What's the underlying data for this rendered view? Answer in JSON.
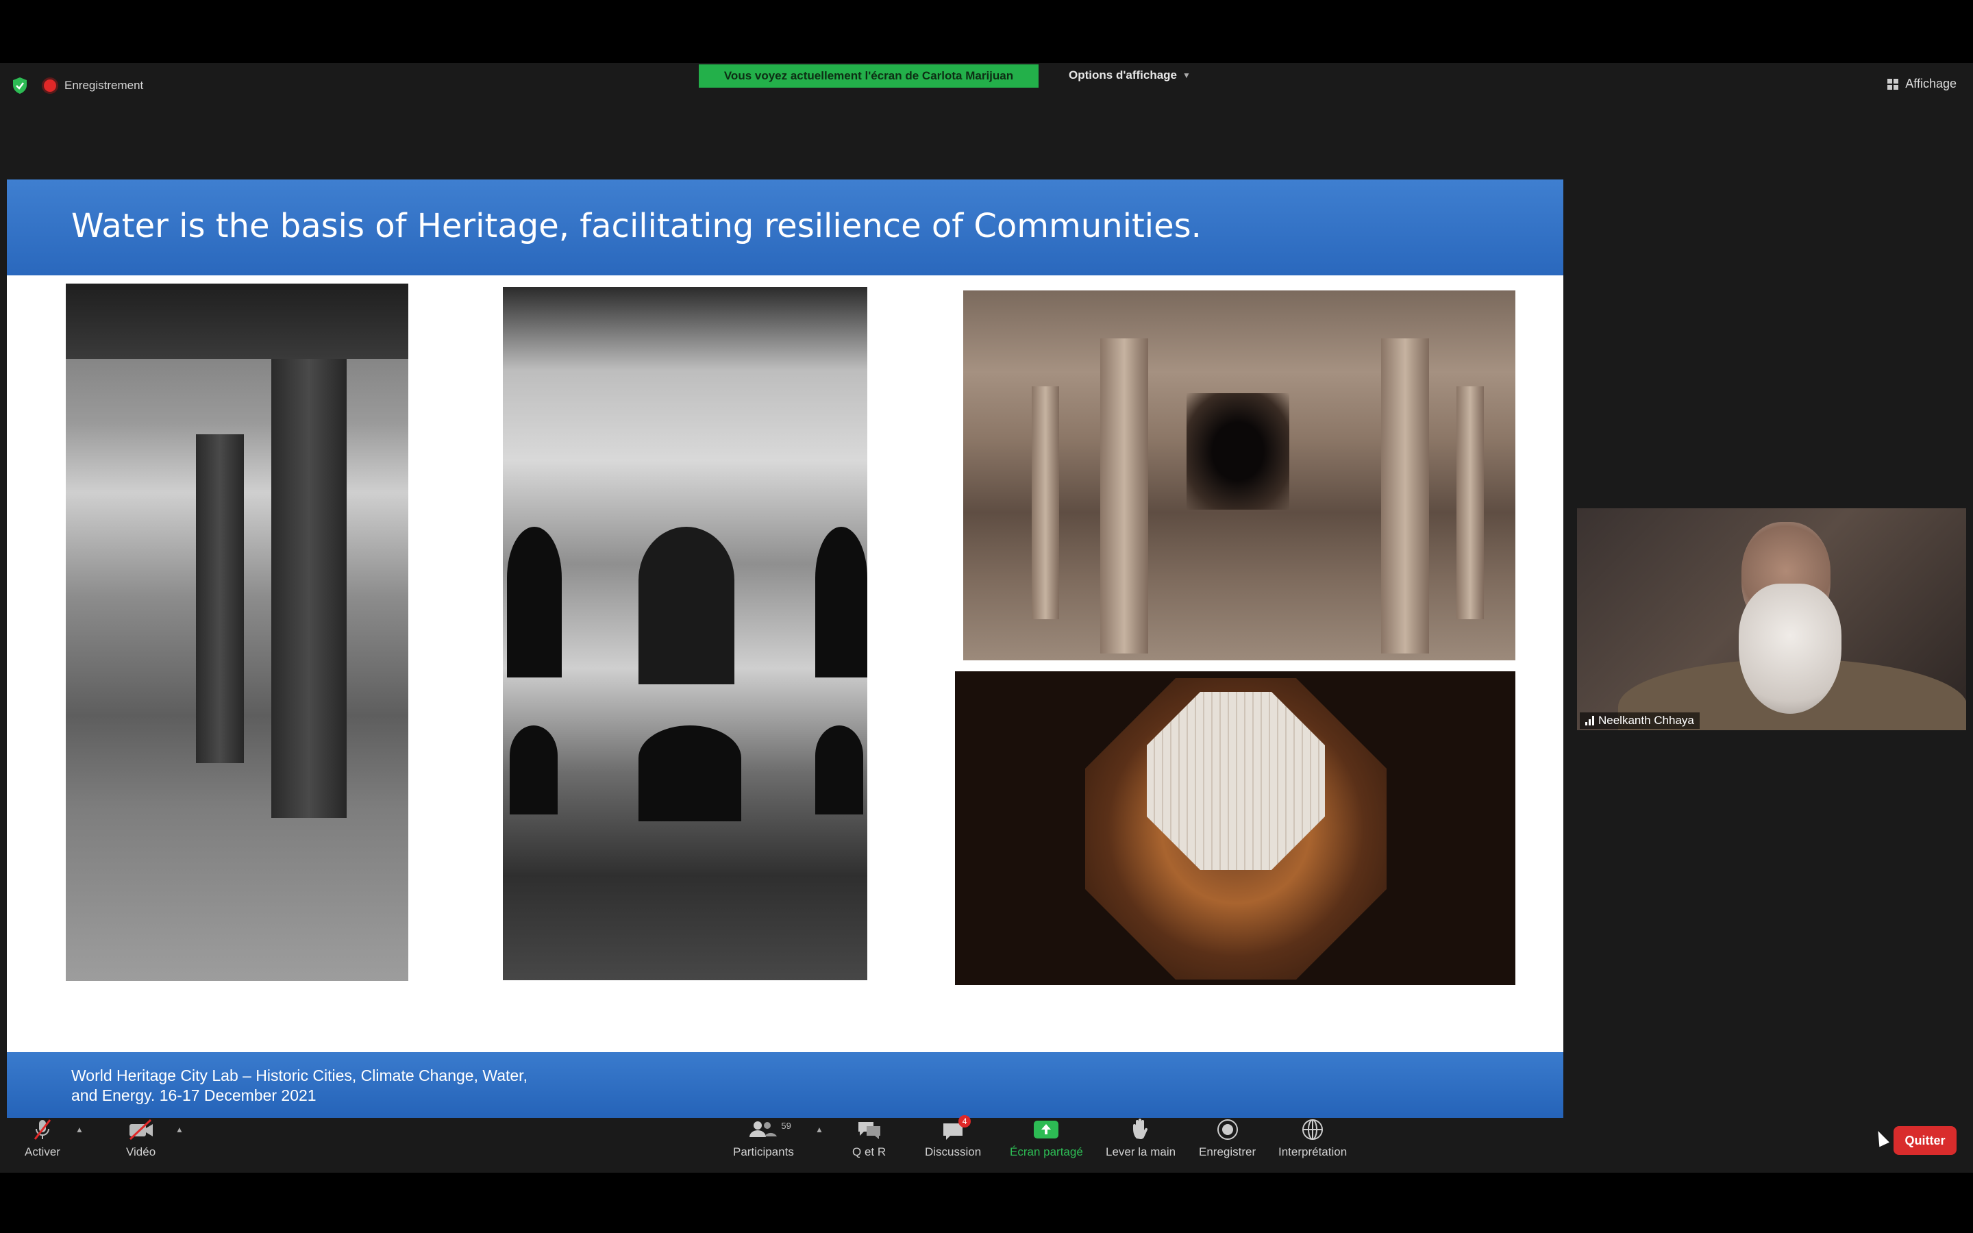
{
  "topbar": {
    "recording_label": "Enregistrement",
    "share_banner": "Vous voyez actuellement l'écran de Carlota Marijuan",
    "view_options": "Options d'affichage",
    "view_button": "Affichage"
  },
  "slide": {
    "title": "Water is the basis of Heritage, facilitating resilience of Communities.",
    "footer": "World Heritage City Lab – Historic Cities, Climate Change, Water, and Energy. 16-17 December 2021"
  },
  "participant": {
    "name": "Neelkanth Chhaya"
  },
  "toolbar": {
    "mute_label": "Activer",
    "video_label": "Vidéo",
    "participants_label": "Participants",
    "participants_count": "59",
    "qa_label": "Q et R",
    "chat_label": "Discussion",
    "chat_badge": "4",
    "share_label": "Écran partagé",
    "raise_hand_label": "Lever la main",
    "record_label": "Enregistrer",
    "interpretation_label": "Interprétation",
    "quit_label": "Quitter"
  },
  "colors": {
    "slide_blue": "#2a68bd",
    "share_green": "#23b04a",
    "quit_red": "#d92c2c",
    "active_green": "#2dbb54"
  }
}
